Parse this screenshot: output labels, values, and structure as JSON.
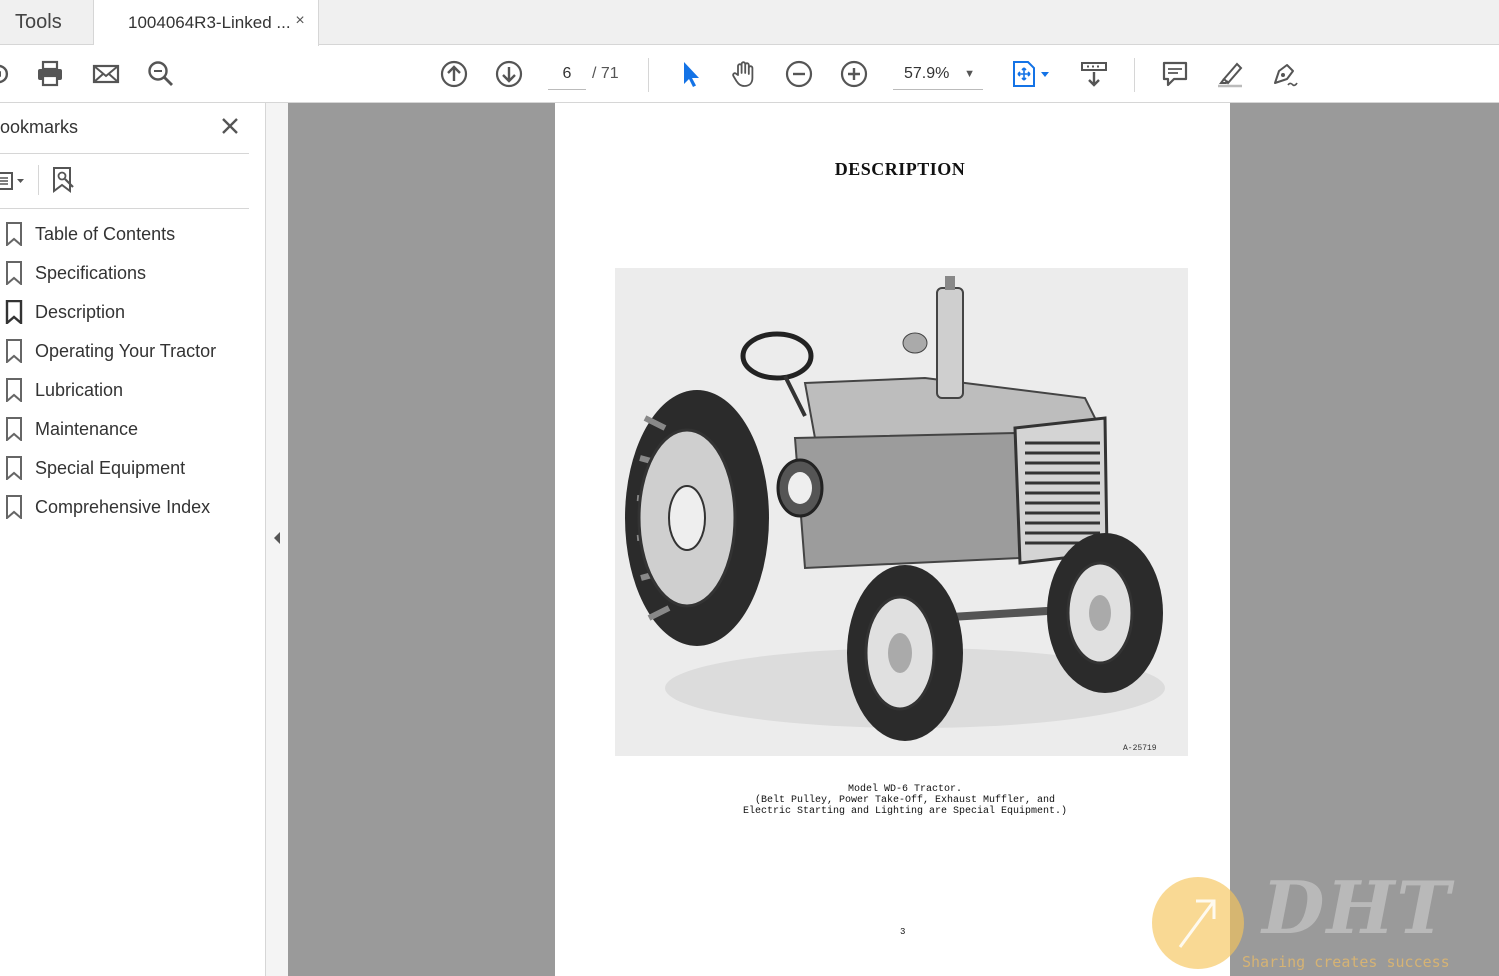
{
  "tabs": {
    "tools_label": "Tools",
    "document_label": "1004064R3-Linked ...",
    "close_symbol": "×"
  },
  "toolbar": {
    "current_page": "6",
    "total_pages": "/ 71",
    "zoom": "57.9%",
    "icons": [
      "share-icon",
      "print-icon",
      "email-icon",
      "search-icon",
      "page-up-icon",
      "page-down-icon",
      "select-cursor-icon",
      "hand-tool-icon",
      "zoom-out-icon",
      "zoom-in-icon",
      "fit-page-icon",
      "scroll-mode-icon",
      "comment-icon",
      "highlight-icon",
      "sign-icon"
    ],
    "accent_color": "#1473e6"
  },
  "sidebar": {
    "title": "ookmarks",
    "items": [
      {
        "label": "Table of Contents"
      },
      {
        "label": "Specifications"
      },
      {
        "label": "Description"
      },
      {
        "label": "Operating Your Tractor"
      },
      {
        "label": "Lubrication"
      },
      {
        "label": "Maintenance"
      },
      {
        "label": "Special Equipment"
      },
      {
        "label": "Comprehensive Index"
      }
    ]
  },
  "document": {
    "heading": "DESCRIPTION",
    "figure_number": "A-25719",
    "caption_lines": [
      "Model WD-6 Tractor.",
      "(Belt Pulley, Power Take-Off, Exhaust Muffler, and",
      "Electric Starting and Lighting are Special Equipment.)"
    ],
    "page_number": "3"
  },
  "watermark": {
    "brand": "DHT",
    "slogan": "Sharing creates success"
  }
}
